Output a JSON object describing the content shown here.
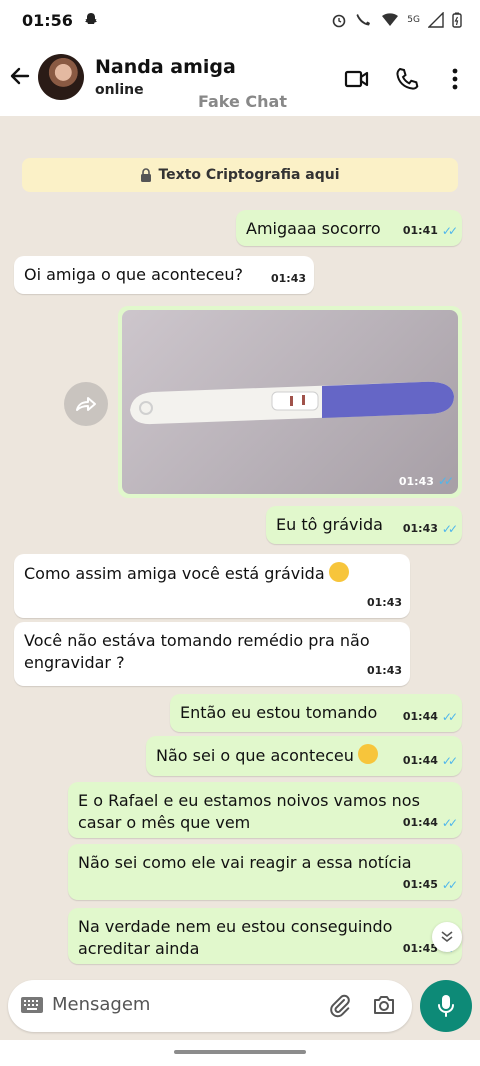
{
  "status_bar": {
    "time": "01:56",
    "network": "5G"
  },
  "header": {
    "contact_name": "Nanda amiga",
    "status": "online",
    "watermark": "Fake Chat"
  },
  "banner": {
    "text": "Texto Criptografia aqui"
  },
  "messages": [
    {
      "dir": "out",
      "text": "Amigaaa socorro",
      "time": "01:41",
      "read": true
    },
    {
      "dir": "in",
      "text": "Oi amiga o que aconteceu?",
      "time": "01:43"
    },
    {
      "dir": "out",
      "type": "image",
      "time": "01:43",
      "read": true
    },
    {
      "dir": "out",
      "text": "Eu tô grávida",
      "time": "01:43",
      "read": true
    },
    {
      "dir": "in",
      "text": "Como assim amiga você está grávida",
      "emoji": "fearful-face",
      "time": "01:43"
    },
    {
      "dir": "in",
      "text": "Você não estáva tomando remédio pra não engravidar ?",
      "time": "01:43"
    },
    {
      "dir": "out",
      "text": "Então eu estou tomando",
      "time": "01:44",
      "read": true
    },
    {
      "dir": "out",
      "text": "Não sei o que aconteceu",
      "emoji": "confused-face",
      "time": "01:44",
      "read": true
    },
    {
      "dir": "out",
      "text": "E o Rafael e eu estamos noivos vamos nos casar o mês que vem",
      "time": "01:44",
      "read": true
    },
    {
      "dir": "out",
      "text": "Não sei como ele vai reagir a essa notícia",
      "time": "01:45",
      "read": true
    },
    {
      "dir": "out",
      "text": "Na verdade nem eu estou conseguindo acreditar ainda",
      "time": "01:45",
      "read": true
    }
  ],
  "input": {
    "placeholder": "Mensagem"
  },
  "colors": {
    "outgoing_bubble": "#e1f8cc",
    "incoming_bubble": "#ffffff",
    "chat_bg": "#ede6dd",
    "accent": "#0d8a77",
    "read_ticks": "#4fb6ec"
  }
}
